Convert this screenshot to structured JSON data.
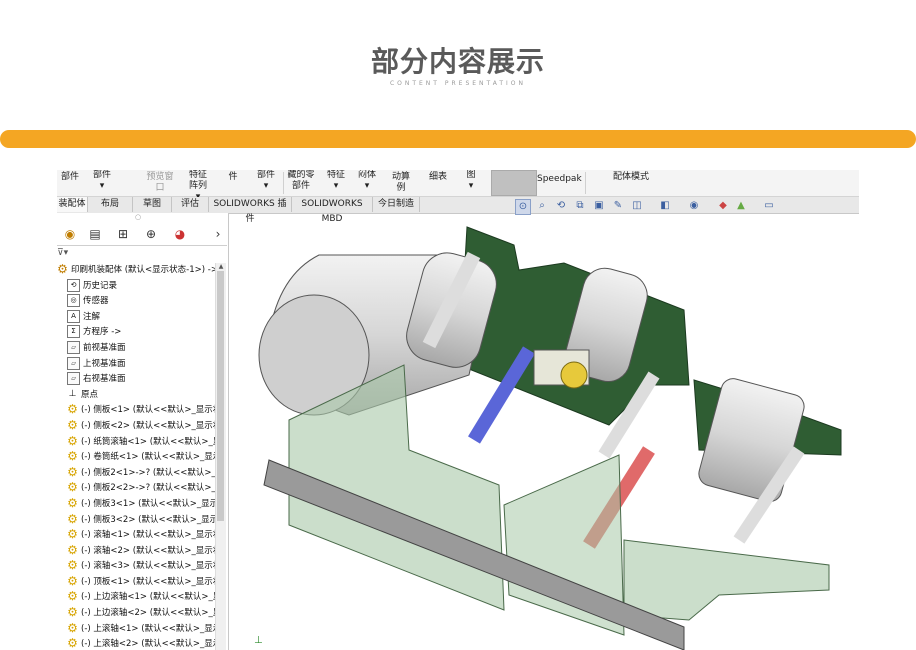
{
  "header": {
    "title": "部分内容展示",
    "subtitle": "CONTENT PRESENTATION"
  },
  "command_manager": {
    "items": [
      {
        "label": "部件",
        "dim": false
      },
      {
        "label": "部件",
        "dim": false
      },
      {
        "label": "预览窗口",
        "dim": true
      },
      {
        "label": "特征阵列",
        "dim": false
      },
      {
        "label": "件",
        "dim": false
      },
      {
        "label": "部件",
        "dim": false
      },
      {
        "label": "藏的零部件",
        "dim": false
      },
      {
        "label": "特征",
        "dim": false
      },
      {
        "label": "闷体",
        "dim": false
      },
      {
        "label": "动算例",
        "dim": false
      },
      {
        "label": "细表",
        "dim": false
      },
      {
        "label": "图",
        "dim": false
      },
      {
        "label": "Speedpak",
        "dim": false
      },
      {
        "label": "配体模式",
        "dim": false
      }
    ]
  },
  "tabs": [
    "装配体",
    "布局",
    "草图",
    "评估",
    "SOLIDWORKS 插件",
    "SOLIDWORKS MBD",
    "今日制造"
  ],
  "feature_tree": {
    "root": "印刷机装配体 (默认<显示状态-1>) ->",
    "items": [
      {
        "label": "历史记录",
        "icon": "history-icon"
      },
      {
        "label": "传感器",
        "icon": "sensor-icon"
      },
      {
        "label": "注解",
        "icon": "annotation-icon"
      },
      {
        "label": "方程序 ->",
        "icon": "equation-icon"
      },
      {
        "label": "前视基准面",
        "icon": "plane-icon"
      },
      {
        "label": "上视基准面",
        "icon": "plane-icon"
      },
      {
        "label": "右视基准面",
        "icon": "plane-icon"
      },
      {
        "label": "原点",
        "icon": "origin-icon"
      },
      {
        "label": "(-) 侧板<1> (默认<<默认>_显示状",
        "icon": "part-icon"
      },
      {
        "label": "(-) 侧板<2> (默认<<默认>_显示状",
        "icon": "part-icon"
      },
      {
        "label": "(-) 纸筒滚轴<1> (默认<<默认>_显",
        "icon": "part-icon"
      },
      {
        "label": "(-) 卷筒纸<1> (默认<<默认>_显示",
        "icon": "part-icon"
      },
      {
        "label": "(-) 侧板2<1>->? (默认<<默认>_显",
        "icon": "part-icon"
      },
      {
        "label": "(-) 侧板2<2>->? (默认<<默认>_显",
        "icon": "part-icon"
      },
      {
        "label": "(-) 侧板3<1> (默认<<默认>_显示状",
        "icon": "part-icon"
      },
      {
        "label": "(-) 侧板3<2> (默认<<默认>_显示状",
        "icon": "part-icon"
      },
      {
        "label": "(-) 滚轴<1> (默认<<默认>_显示状",
        "icon": "part-icon"
      },
      {
        "label": "(-) 滚轴<2> (默认<<默认>_显示状",
        "icon": "part-icon"
      },
      {
        "label": "(-) 滚轴<3> (默认<<默认>_显示状",
        "icon": "part-icon"
      },
      {
        "label": "(-) 顶板<1> (默认<<默认>_显示状",
        "icon": "part-icon"
      },
      {
        "label": "(-) 上边滚轴<1> (默认<<默认>_显",
        "icon": "part-icon"
      },
      {
        "label": "(-) 上边滚轴<2> (默认<<默认>_显",
        "icon": "part-icon"
      },
      {
        "label": "(-) 上滚轴<1> (默认<<默认>_显示",
        "icon": "part-icon"
      },
      {
        "label": "(-) 上滚轴<2> (默认<<默认>_显示",
        "icon": "part-icon"
      }
    ]
  },
  "colors": {
    "accent_bar": "#f4a623",
    "plate_green": "#2f5d33",
    "glass": "#a8c8a8"
  }
}
